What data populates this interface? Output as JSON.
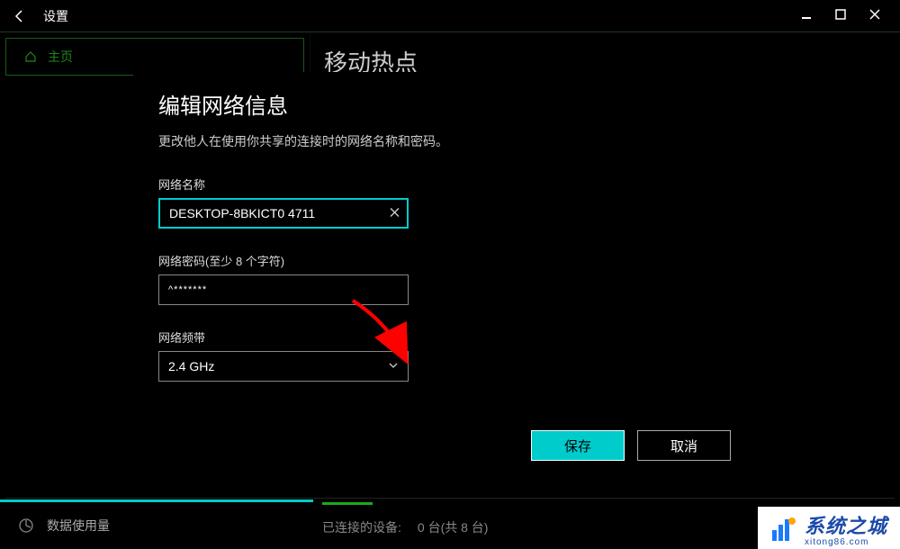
{
  "titlebar": {
    "title": "设置"
  },
  "sidebar": {
    "home_label": "主页",
    "data_usage_label": "数据使用量"
  },
  "page": {
    "title": "移动热点",
    "connected_label": "已连接的设备:",
    "connected_value": "0 台(共 8 台)"
  },
  "dialog": {
    "title": "编辑网络信息",
    "description": "更改他人在使用你共享的连接时的网络名称和密码。",
    "network_name_label": "网络名称",
    "network_name_value": "DESKTOP-8BKICT0 4711",
    "network_password_label": "网络密码(至少 8 个字符)",
    "network_password_value": "^*******",
    "network_band_label": "网络频带",
    "network_band_value": "2.4 GHz",
    "save_label": "保存",
    "cancel_label": "取消"
  },
  "watermark": {
    "brand": "系统之城",
    "url": "xitong86.com"
  },
  "colors": {
    "accent": "#00cccc",
    "green": "#1a8a1a",
    "arrow": "#ff0000"
  }
}
